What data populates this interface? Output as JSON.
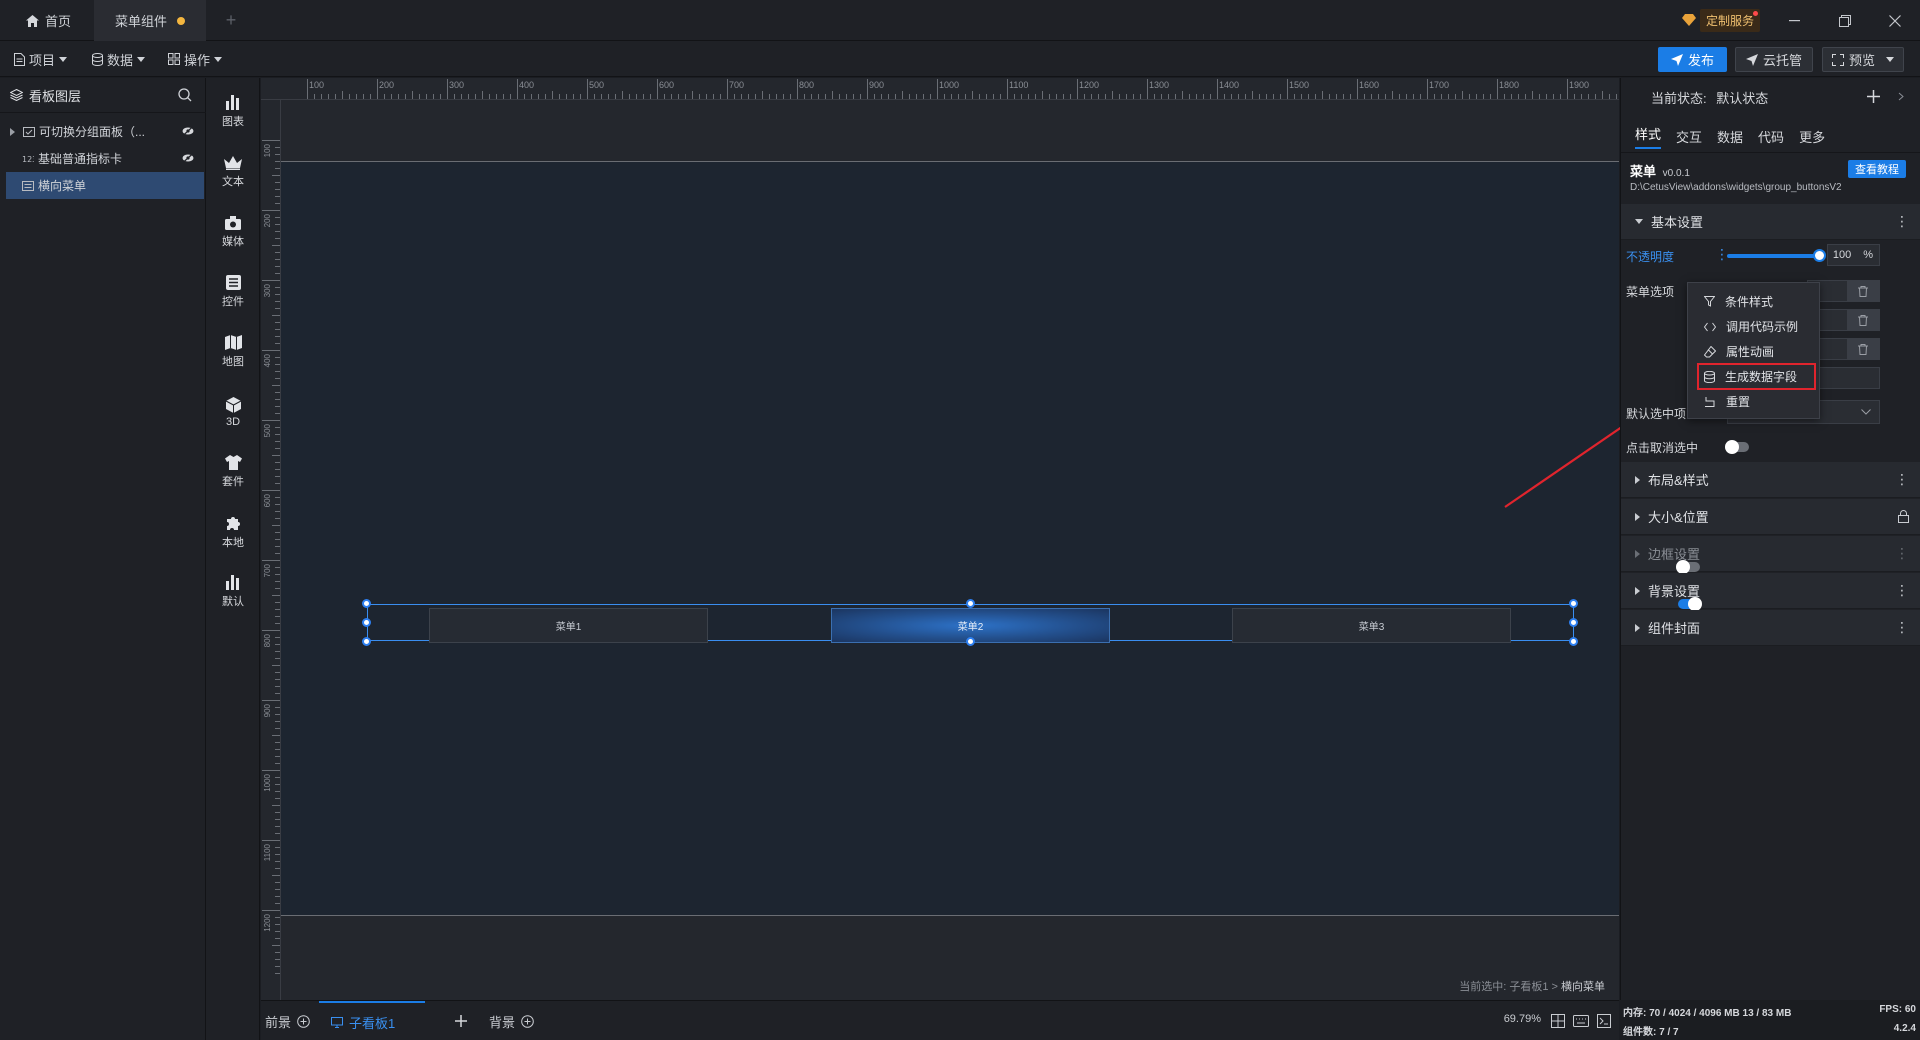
{
  "titlebar": {
    "tabs": [
      {
        "label": "首页"
      },
      {
        "label": "菜单组件"
      }
    ],
    "custom_service": "定制服务"
  },
  "toolbar": {
    "project": "项目",
    "data": "数据",
    "operation": "操作",
    "publish": "发布",
    "cloud": "云托管",
    "preview": "预览"
  },
  "layers": {
    "title": "看板图层",
    "items": [
      {
        "label": "可切换分组面板（..."
      },
      {
        "label": "基础普通指标卡"
      },
      {
        "label": "横向菜单"
      }
    ]
  },
  "iconbar": {
    "items": [
      {
        "label": "图表"
      },
      {
        "label": "文本"
      },
      {
        "label": "媒体"
      },
      {
        "label": "控件"
      },
      {
        "label": "地图"
      },
      {
        "label": "3D"
      },
      {
        "label": "套件"
      },
      {
        "label": "本地"
      },
      {
        "label": "默认"
      }
    ]
  },
  "ruler": {
    "top_ticks": [
      "100",
      "200",
      "300",
      "400",
      "500",
      "600",
      "700",
      "800",
      "900",
      "1000",
      "1100",
      "1200",
      "1300",
      "1400",
      "1500",
      "1600",
      "1700",
      "1800",
      "1900"
    ],
    "left_ticks": [
      "100",
      "200",
      "300",
      "400",
      "500",
      "600",
      "700",
      "800",
      "900",
      "1000",
      "1100",
      "1200"
    ]
  },
  "canvas": {
    "menu_items": [
      {
        "label": "菜单1"
      },
      {
        "label": "菜单2"
      },
      {
        "label": "菜单3"
      }
    ],
    "selection_prefix": "当前选中: 子看板1 > ",
    "selection_current": "横向菜单"
  },
  "bottombar": {
    "foreground": "前景",
    "board": "子看板1",
    "background": "背景",
    "zoom": "69.79%"
  },
  "rightpanel": {
    "state_label": "当前状态:",
    "state_value": "默认状态",
    "tabs": [
      "样式",
      "交互",
      "数据",
      "代码",
      "更多"
    ],
    "widget_name": "菜单",
    "widget_version": "v0.0.1",
    "tutorial_button": "查看教程",
    "widget_path": "D:\\CetusView\\addons\\widgets\\group_buttonsV2",
    "basic_settings": "基本设置",
    "opacity_label": "不透明度",
    "opacity_value": "100",
    "opacity_unit": "%",
    "menu_options_label": "菜单选项",
    "default_selected_label": "默认选中项",
    "click_deselect_label": "点击取消选中",
    "sections": [
      {
        "label": "布局&样式"
      },
      {
        "label": "大小&位置"
      },
      {
        "label": "边框设置"
      },
      {
        "label": "背景设置"
      },
      {
        "label": "组件封面"
      }
    ]
  },
  "context_menu": {
    "items": [
      {
        "label": "条件样式"
      },
      {
        "label": "调用代码示例"
      },
      {
        "label": "属性动画"
      },
      {
        "label": "生成数据字段"
      },
      {
        "label": "重置"
      }
    ]
  },
  "status": {
    "memory": "内存:  70 / 4024 / 4096 MB  13 / 83 MB",
    "fps": "FPS:  60",
    "components": "组件数: 7 / 7",
    "version": "4.2.4"
  },
  "colors": {
    "accent": "#1b7de6",
    "highlight_box": "#e0242d",
    "active_tab_dot": "#f4b63f"
  }
}
